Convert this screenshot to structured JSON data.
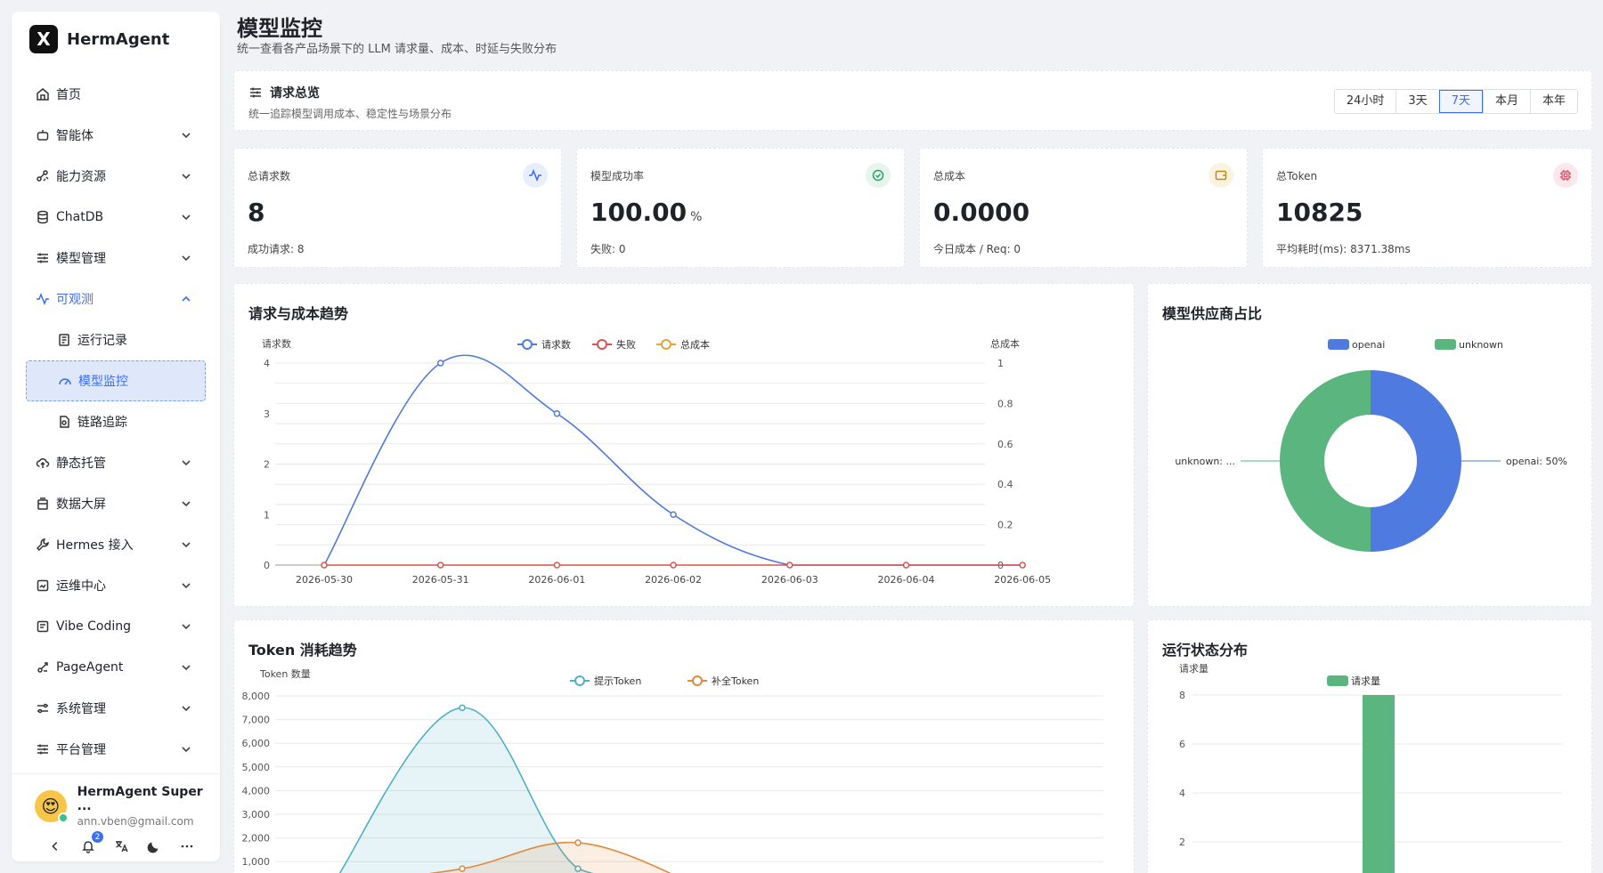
{
  "brand": {
    "logo": "X",
    "name": "HermAgent"
  },
  "sidebar": {
    "items": [
      {
        "label": "首页",
        "icon": "home-icon"
      },
      {
        "label": "智能体",
        "icon": "robot-icon"
      },
      {
        "label": "能力资源",
        "icon": "nodes-icon"
      },
      {
        "label": "ChatDB",
        "icon": "database-icon"
      },
      {
        "label": "模型管理",
        "icon": "sliders-icon"
      },
      {
        "label": "可观测",
        "icon": "pulse-icon"
      },
      {
        "label": "静态托管",
        "icon": "cloud-upload-icon"
      },
      {
        "label": "数据大屏",
        "icon": "screen-icon"
      },
      {
        "label": "Hermes 接入",
        "icon": "wrench-icon"
      },
      {
        "label": "运维中心",
        "icon": "ops-icon"
      },
      {
        "label": "Vibe Coding",
        "icon": "code-icon"
      },
      {
        "label": "PageAgent",
        "icon": "agent-icon"
      },
      {
        "label": "系统管理",
        "icon": "settings-icon"
      },
      {
        "label": "平台管理",
        "icon": "platform-icon"
      }
    ],
    "subitems": [
      {
        "label": "运行记录",
        "icon": "record-icon"
      },
      {
        "label": "模型监控",
        "icon": "gauge-icon"
      },
      {
        "label": "链路追踪",
        "icon": "trace-icon"
      }
    ]
  },
  "user": {
    "name": "HermAgent Super ...",
    "email": "ann.vben@gmail.com",
    "notifications": "2"
  },
  "page": {
    "title": "模型监控",
    "subtitle": "统一查看各产品场景下的 LLM 请求量、成本、时延与失败分布"
  },
  "overview": {
    "title": "请求总览",
    "subtitle": "统一追踪模型调用成本、稳定性与场景分布",
    "ranges": [
      "24小时",
      "3天",
      "7天",
      "本月",
      "本年"
    ],
    "active_range": "7天"
  },
  "stats": [
    {
      "label": "总请求数",
      "value": "8",
      "unit": "",
      "foot": "成功请求: 8",
      "icon": "pulse-icon",
      "color": "#3b6ef5"
    },
    {
      "label": "模型成功率",
      "value": "100.00",
      "unit": "%",
      "foot": "失败: 0",
      "icon": "check-circle-icon",
      "color": "#2f9e6e"
    },
    {
      "label": "总成本",
      "value": "0.0000",
      "unit": "",
      "foot": "今日成本 / Req: 0",
      "icon": "wallet-icon",
      "color": "#c28a16"
    },
    {
      "label": "总Token",
      "value": "10825",
      "unit": "",
      "foot": "平均耗时(ms): 8371.38ms",
      "icon": "chip-icon",
      "color": "#e0566b"
    }
  ],
  "charts": {
    "trend_title": "请求与成本趋势",
    "provider_title": "模型供应商占比",
    "token_title": "Token 消耗趋势",
    "status_title": "运行状态分布"
  },
  "chart_data": [
    {
      "type": "line",
      "title": "请求与成本趋势",
      "x": [
        "2026-05-30",
        "2026-05-31",
        "2026-06-01",
        "2026-06-02",
        "2026-06-03",
        "2026-06-04",
        "2026-06-05"
      ],
      "ylabel": "请求数",
      "y2label": "总成本",
      "ylim": [
        0,
        4
      ],
      "y_ticks": [
        "0",
        "1",
        "2",
        "3",
        "4"
      ],
      "y2lim": [
        0,
        1
      ],
      "y2_ticks": [
        "0",
        "0.2",
        "0.4",
        "0.6",
        "0.8",
        "1"
      ],
      "legend_position": "top-center",
      "series": [
        {
          "name": "请求数",
          "values": [
            0,
            4,
            3,
            1,
            0,
            0,
            0
          ],
          "color": "#4f7ae0"
        },
        {
          "name": "失败",
          "values": [
            0,
            0,
            0,
            0,
            0,
            0,
            0
          ],
          "color": "#d9534f"
        },
        {
          "name": "总成本",
          "values": [
            0,
            0,
            0,
            0,
            0,
            0,
            0
          ],
          "color": "#e6a53a"
        }
      ]
    },
    {
      "type": "pie",
      "title": "模型供应商占比",
      "legend_position": "top-center",
      "slices": [
        {
          "name": "openai",
          "value": 50,
          "label": "openai: 50%",
          "color": "#4f7ae0"
        },
        {
          "name": "unknown",
          "value": 50,
          "label": "unknown: ...",
          "color": "#5ab57f"
        }
      ]
    },
    {
      "type": "area",
      "title": "Token 消耗趋势",
      "ylabel": "Token 数量",
      "y_ticks": [
        "1,000",
        "2,000",
        "3,000",
        "4,000",
        "5,000",
        "6,000",
        "7,000",
        "8,000"
      ],
      "ylim": [
        0,
        8000
      ],
      "legend_position": "top-center",
      "series": [
        {
          "name": "提示Token",
          "values": [
            0,
            7500,
            700,
            0
          ],
          "color": "#4fb0c6"
        },
        {
          "name": "补全Token",
          "values": [
            0,
            700,
            1800,
            0
          ],
          "color": "#e08a3c"
        }
      ]
    },
    {
      "type": "bar",
      "title": "运行状态分布",
      "ylabel": "请求量",
      "y_ticks": [
        "2",
        "4",
        "6",
        "8"
      ],
      "ylim": [
        0,
        8
      ],
      "legend_position": "top-center",
      "series": [
        {
          "name": "请求量",
          "values": [
            8
          ],
          "color": "#5ab57f"
        }
      ]
    }
  ]
}
